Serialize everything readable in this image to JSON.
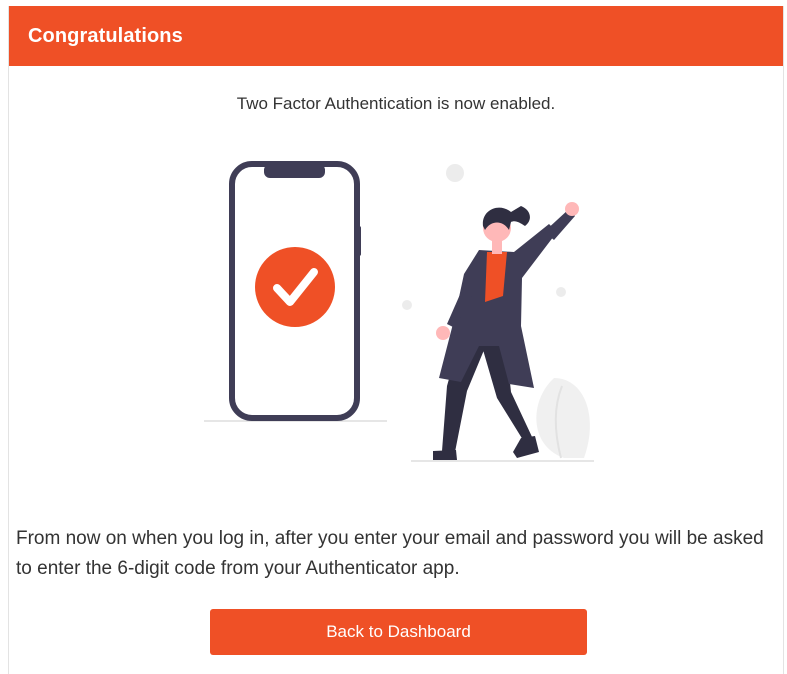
{
  "card": {
    "title": "Congratulations",
    "subtitle": "Two Factor Authentication is now enabled.",
    "description": "From now on when you log in, after you enter your email and password you will be asked to enter the 6-digit code from your Authenticator app.",
    "button_label": "Back to Dashboard"
  },
  "illustration": {
    "phone_icon": "smartphone-icon",
    "check_icon": "checkmark-icon",
    "figure": "celebrating-person"
  },
  "colors": {
    "accent": "#ef5026",
    "dark": "#3f3d56",
    "text": "#333333",
    "white": "#ffffff"
  }
}
